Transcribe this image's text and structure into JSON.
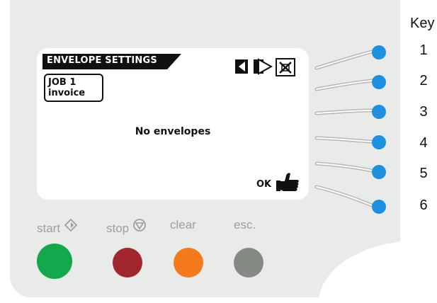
{
  "screen": {
    "title": "ENVELOPE SETTINGS",
    "job_line1": "JOB  1",
    "job_line2": "invoice",
    "status": "No envelopes",
    "ok_label": "OK"
  },
  "key_panel": {
    "header": "Key",
    "keys": [
      "1",
      "2",
      "3",
      "4",
      "5",
      "6"
    ],
    "key_color": "#1e90e0"
  },
  "buttons": {
    "start_label": "start",
    "stop_label": "stop",
    "clear_label": "clear",
    "esc_label": "esc.",
    "start_color": "#12a84b",
    "stop_color": "#a1262e",
    "clear_color": "#f47a1c",
    "esc_color": "#858b84"
  },
  "icons": {
    "start": "start-diamond-icon",
    "stop": "stop-circle-icon",
    "left_arrow": "left-arrow-icon",
    "diamond": "split-diamond-icon",
    "cancel": "cancel-box-icon",
    "hand": "thumbs-hand-icon"
  }
}
